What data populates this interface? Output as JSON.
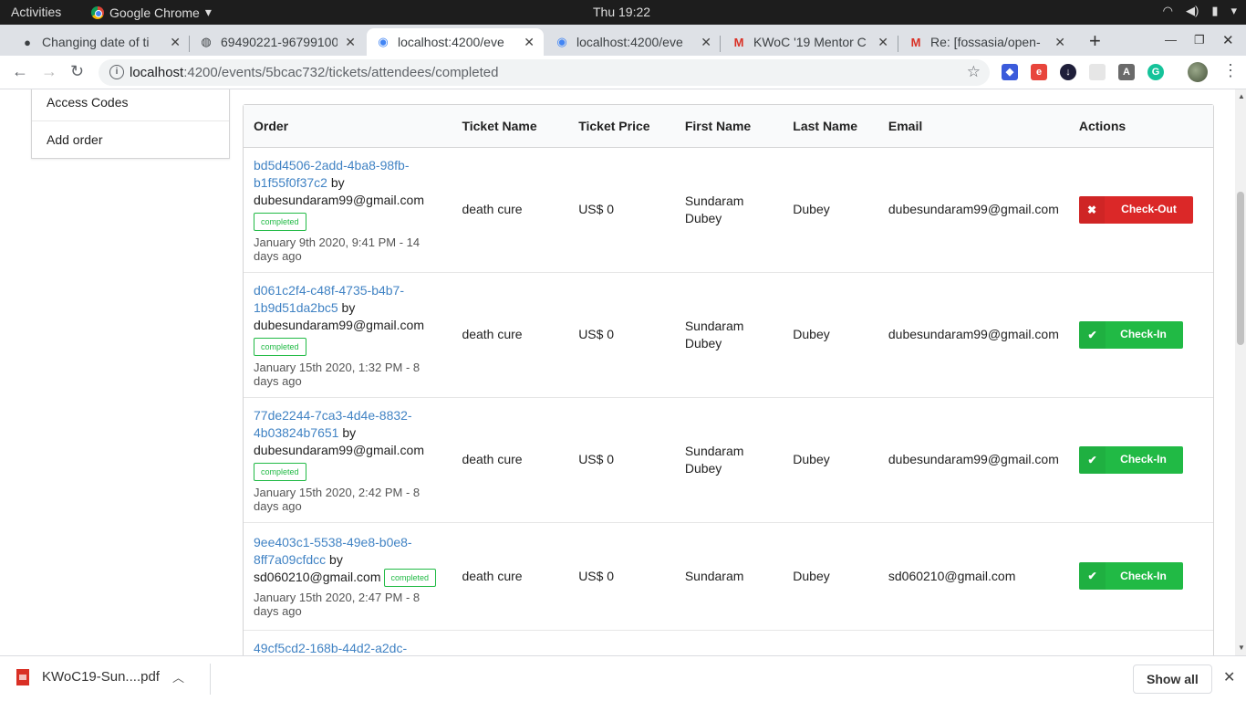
{
  "os": {
    "activities": "Activities",
    "app_name": "Google Chrome",
    "clock": "Thu 19:22"
  },
  "tabs": [
    {
      "title": "Changing date of ti",
      "icon": "github-icon"
    },
    {
      "title": "69490221-96799100",
      "icon": "globe-icon"
    },
    {
      "title": "localhost:4200/eve",
      "icon": "site-icon",
      "active": true
    },
    {
      "title": "localhost:4200/eve",
      "icon": "site-icon"
    },
    {
      "title": "KWoC '19 Mentor C",
      "icon": "gmail-icon"
    },
    {
      "title": "Re: [fossasia/open-",
      "icon": "gmail-icon"
    }
  ],
  "address": {
    "host": "localhost",
    "path": ":4200/events/5bcac732/tickets/attendees/completed"
  },
  "sidebar": {
    "items": [
      "Access Codes",
      "Add order"
    ]
  },
  "table": {
    "headers": [
      "Order",
      "Ticket Name",
      "Ticket Price",
      "First Name",
      "Last Name",
      "Email",
      "Actions"
    ],
    "rows": [
      {
        "order_id": "bd5d4506-2add-4ba8-98fb-b1f55f0f37c2",
        "by": "by",
        "buyer": "dubesundaram99@gmail.com",
        "status": "completed",
        "date": "January 9th 2020, 9:41 PM - 14 days ago",
        "ticket_name": "death cure",
        "ticket_price": "US$ 0",
        "first_name": "Sundaram Dubey",
        "last_name": "Dubey",
        "email": "dubesundaram99@gmail.com",
        "action": "Check-Out"
      },
      {
        "order_id": "d061c2f4-c48f-4735-b4b7-1b9d51da2bc5",
        "by": "by",
        "buyer": "dubesundaram99@gmail.com",
        "status": "completed",
        "date": "January 15th 2020, 1:32 PM - 8 days ago",
        "ticket_name": "death cure",
        "ticket_price": "US$ 0",
        "first_name": "Sundaram Dubey",
        "last_name": "Dubey",
        "email": "dubesundaram99@gmail.com",
        "action": "Check-In"
      },
      {
        "order_id": "77de2244-7ca3-4d4e-8832-4b03824b7651",
        "by": "by",
        "buyer": "dubesundaram99@gmail.com",
        "status": "completed",
        "date": "January 15th 2020, 2:42 PM - 8 days ago",
        "ticket_name": "death cure",
        "ticket_price": "US$ 0",
        "first_name": "Sundaram Dubey",
        "last_name": "Dubey",
        "email": "dubesundaram99@gmail.com",
        "action": "Check-In"
      },
      {
        "order_id": "9ee403c1-5538-49e8-b0e8-8ff7a09cfdcc",
        "by": "by",
        "buyer": "sd060210@gmail.com",
        "status": "completed",
        "date": "January 15th 2020, 2:47 PM - 8 days ago",
        "ticket_name": "death cure",
        "ticket_price": "US$ 0",
        "first_name": "Sundaram",
        "last_name": "Dubey",
        "email": "sd060210@gmail.com",
        "action": "Check-In"
      },
      {
        "order_id": "49cf5cd2-168b-44d2-a2dc-"
      }
    ]
  },
  "downloads": {
    "file": "KWoC19-Sun....pdf",
    "show_all": "Show all"
  },
  "colors": {
    "checkout": "#db2828",
    "checkin": "#21ba45",
    "link": "#4183c4"
  }
}
